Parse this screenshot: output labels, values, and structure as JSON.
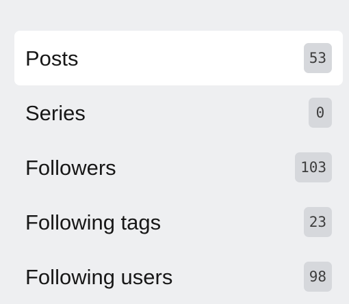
{
  "nav": {
    "items": [
      {
        "label": "Posts",
        "count": "53",
        "active": true
      },
      {
        "label": "Series",
        "count": "0",
        "active": false
      },
      {
        "label": "Followers",
        "count": "103",
        "active": false
      },
      {
        "label": "Following tags",
        "count": "23",
        "active": false
      },
      {
        "label": "Following users",
        "count": "98",
        "active": false
      }
    ]
  }
}
